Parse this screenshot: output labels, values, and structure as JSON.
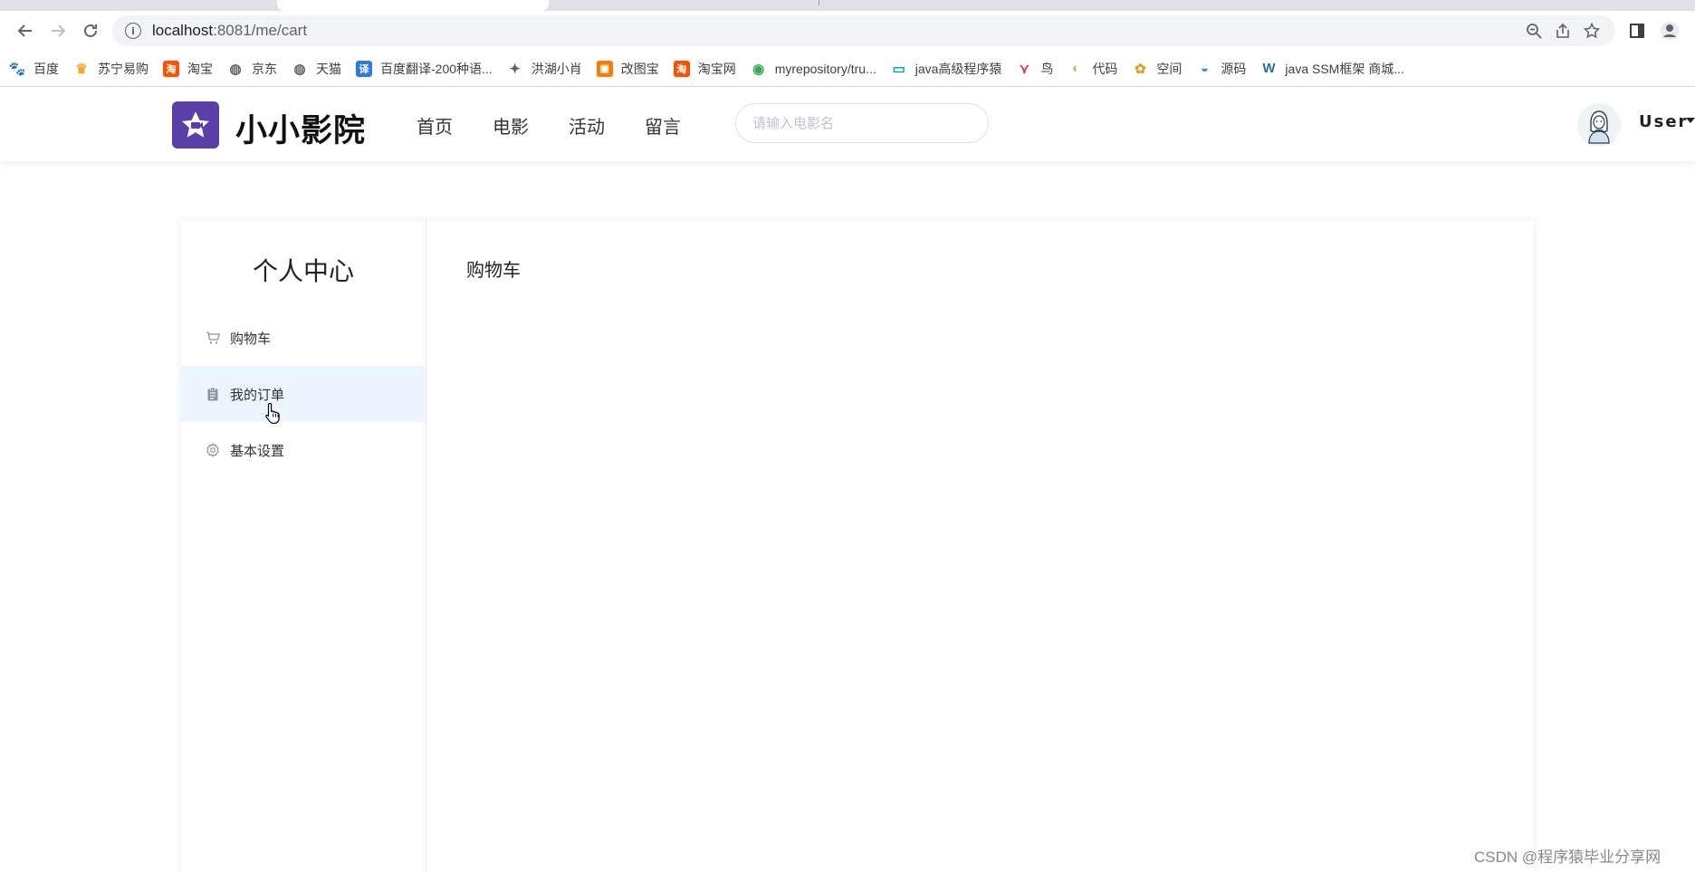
{
  "browser": {
    "url_host": "localhost",
    "url_path": ":8081/me/cart",
    "bookmarks": [
      {
        "label": "百度",
        "icon": "baidu-paw-icon",
        "color": "#2932e1"
      },
      {
        "label": "苏宁易购",
        "icon": "suning-lion-icon",
        "color": "#f5a623"
      },
      {
        "label": "淘宝",
        "icon": "taobao-icon",
        "color": "#ff5000"
      },
      {
        "label": "京东",
        "icon": "globe-icon",
        "color": "#5f6368"
      },
      {
        "label": "天猫",
        "icon": "globe-icon",
        "color": "#5f6368"
      },
      {
        "label": "百度翻译-200种语...",
        "icon": "translate-icon",
        "color": "#2c7be5"
      },
      {
        "label": "洪湖小肖",
        "icon": "bird-icon",
        "color": "#5f6368"
      },
      {
        "label": "改图宝",
        "icon": "gaitubao-icon",
        "color": "#ff7a00"
      },
      {
        "label": "淘宝网",
        "icon": "taobao-icon",
        "color": "#ff5000"
      },
      {
        "label": "myrepository/tru...",
        "icon": "chrome-icon",
        "color": "#34a853"
      },
      {
        "label": "java高级程序猿",
        "icon": "bilibili-icon",
        "color": "#00a1d6"
      },
      {
        "label": "鸟",
        "icon": "red-bird-icon",
        "color": "#e53935"
      },
      {
        "label": "代码",
        "icon": "leaf-icon",
        "color": "#c8b86a"
      },
      {
        "label": "空间",
        "icon": "qzone-icon",
        "color": "#e0a020"
      },
      {
        "label": "源码",
        "icon": "docker-whale-icon",
        "color": "#1d9ad6"
      },
      {
        "label": "java SSM框架 商城...",
        "icon": "wordpress-icon",
        "color": "#21759b"
      }
    ]
  },
  "header": {
    "site_name": "小小影院",
    "nav": [
      "首页",
      "电影",
      "活动",
      "留言"
    ],
    "search_placeholder": "请输入电影名",
    "user_name": "User",
    "brand_color": "#5b3fa8"
  },
  "sidebar": {
    "title": "个人中心",
    "items": [
      {
        "label": "购物车",
        "icon": "cart-icon",
        "active": false
      },
      {
        "label": "我的订单",
        "icon": "clipboard-icon",
        "active": true
      },
      {
        "label": "基本设置",
        "icon": "gear-icon",
        "active": false
      }
    ]
  },
  "main": {
    "title": "购物车"
  },
  "watermark": "CSDN @程序猿毕业分享网"
}
